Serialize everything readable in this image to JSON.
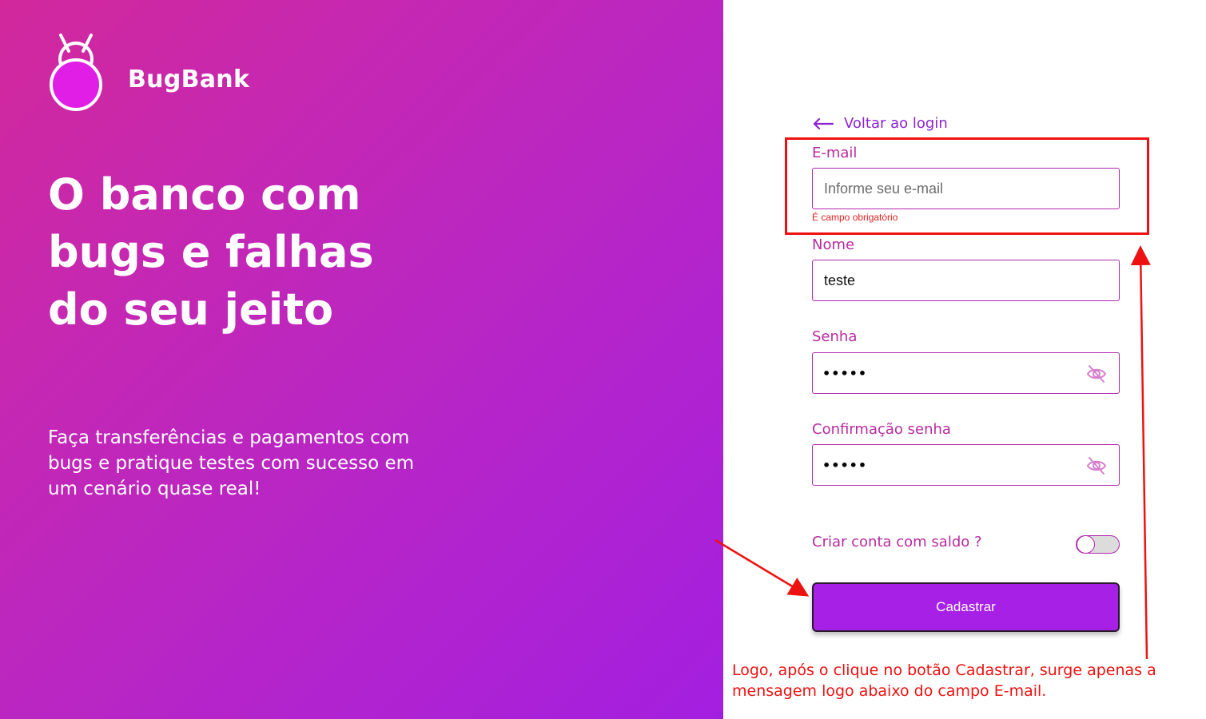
{
  "brand": {
    "name": "BugBank"
  },
  "hero": {
    "headline_lines": [
      "O banco com",
      "bugs e falhas",
      "do seu jeito"
    ],
    "subtext_lines": [
      "Faça transferências e pagamentos com",
      "bugs e pratique testes com sucesso em",
      "um cenário quase real!"
    ]
  },
  "form": {
    "back_link": "Voltar ao login",
    "email": {
      "label": "E-mail",
      "placeholder": "Informe seu e-mail",
      "value": "",
      "error": "É campo obrigatório"
    },
    "name": {
      "label": "Nome",
      "value": "teste"
    },
    "password": {
      "label": "Senha",
      "value": "•••••"
    },
    "password_confirm": {
      "label": "Confirmação senha",
      "value": "•••••"
    },
    "balance_toggle": {
      "label": "Criar conta com saldo ?",
      "checked": false
    },
    "submit_label": "Cadastrar"
  },
  "annotation": {
    "lines": [
      "Logo, após o clique no botão Cadastrar, surge apenas a",
      "mensagem logo abaixo do campo E-mail."
    ],
    "color": "#ee1111"
  },
  "colors": {
    "accent": "#a620e5",
    "label": "#b82a9f",
    "error": "#e02020"
  }
}
